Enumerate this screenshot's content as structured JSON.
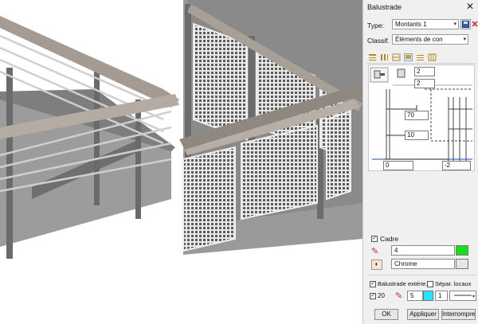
{
  "dialog": {
    "title": "Balustrade",
    "type_label": "Type:",
    "type_value": "Montants 1",
    "classif_label": "Classif.",
    "classif_value": "Éléments de con",
    "dims": {
      "top_1": "2",
      "top_2": "2",
      "d70": "70",
      "d10": "10",
      "d0": "0",
      "dneg2": "-2"
    },
    "cadre_label": "Cadre",
    "cadre_checked": true,
    "cadre_value": "4",
    "cadre_color": "#16e016",
    "material_value": "Chrome",
    "material_color": "#e6e6e6",
    "opt_exterior_label": "Balustrade extérie.",
    "opt_exterior_checked": true,
    "opt_separate_label": "Sépar. locaux",
    "opt_separate_checked": false,
    "line_count_label": "20",
    "line_count_checked": true,
    "pen_value": "5",
    "pen_color": "#22e6ff",
    "line_value": "1",
    "buttons": {
      "ok": "OK",
      "apply": "Appliquer",
      "interrupt": "Interrompre"
    }
  }
}
